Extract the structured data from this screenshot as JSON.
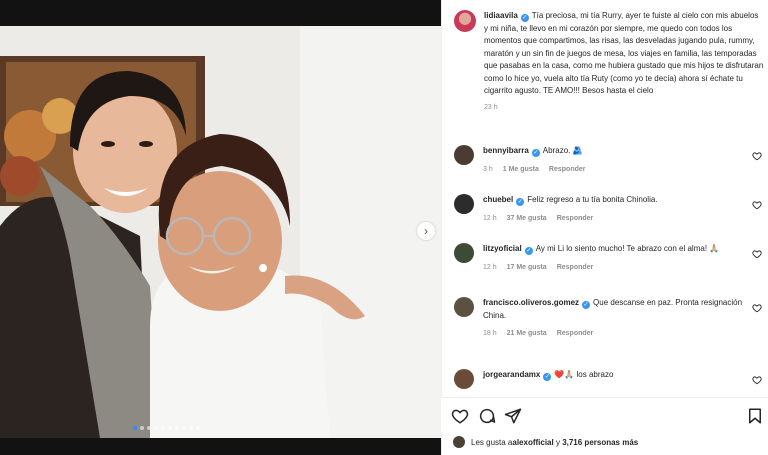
{
  "post": {
    "author": "lidiaavila",
    "caption": "Tía preciosa, mi tía Rurry, ayer te fuiste al cielo con mis abuelos y mi niña, te llevo en mi corazón por siempre, me quedo con todos los momentos que compartimos, las risas, las desveladas jugando pula, rummy, maratón y un sin fin de juegos de mesa, los viajes en familia, las temporadas que pasabas en la casa, como me hubiera gustado que mis hijos te disfrutaran como lo hice yo, vuela alto tía Ruty (como yo te decía) ahora sí échate tu cigarrito agusto. TE AMO!!! Besos hasta el cielo",
    "time": "23 h"
  },
  "carousel": {
    "next_icon": "chevron-right-icon",
    "dot_count": 10,
    "active_index": 0
  },
  "comments": [
    {
      "user": "bennyibarra",
      "text": "Abrazo. 🫂",
      "time": "3 h",
      "likes": "1 Me gusta",
      "reply": "Responder",
      "avatar_color": "#4a3b33"
    },
    {
      "user": "chuebel",
      "text": "Feliz regreso a tu tía bonita Chinolia.",
      "time": "12 h",
      "likes": "37 Me gusta",
      "reply": "Responder",
      "avatar_color": "#2c2c2c"
    },
    {
      "user": "litzyoficial",
      "text": "Ay mi Li lo siento mucho! Te abrazo con el alma! 🙏🏼",
      "time": "12 h",
      "likes": "17 Me gusta",
      "reply": "Responder",
      "avatar_color": "#3d4a35"
    },
    {
      "user": "francisco.oliveros.gomez",
      "text": "Que descanse en paz. Pronta resignación China.",
      "time": "18 h",
      "likes": "21 Me gusta",
      "reply": "Responder",
      "avatar_color": "#5a5140"
    },
    {
      "user": "jorgearandamx",
      "text": "❤️🙏🏼 los abrazo",
      "time": "",
      "likes": "",
      "reply": "",
      "avatar_color": "#6b4a3a"
    }
  ],
  "likes_summary": {
    "prefix": "Les gusta a ",
    "user": "alexofficial",
    "middle": " y ",
    "count": "3,716 personas más"
  },
  "colors": {
    "verified": "#3897f0",
    "muted": "#8e8e8e",
    "text": "#262626"
  }
}
